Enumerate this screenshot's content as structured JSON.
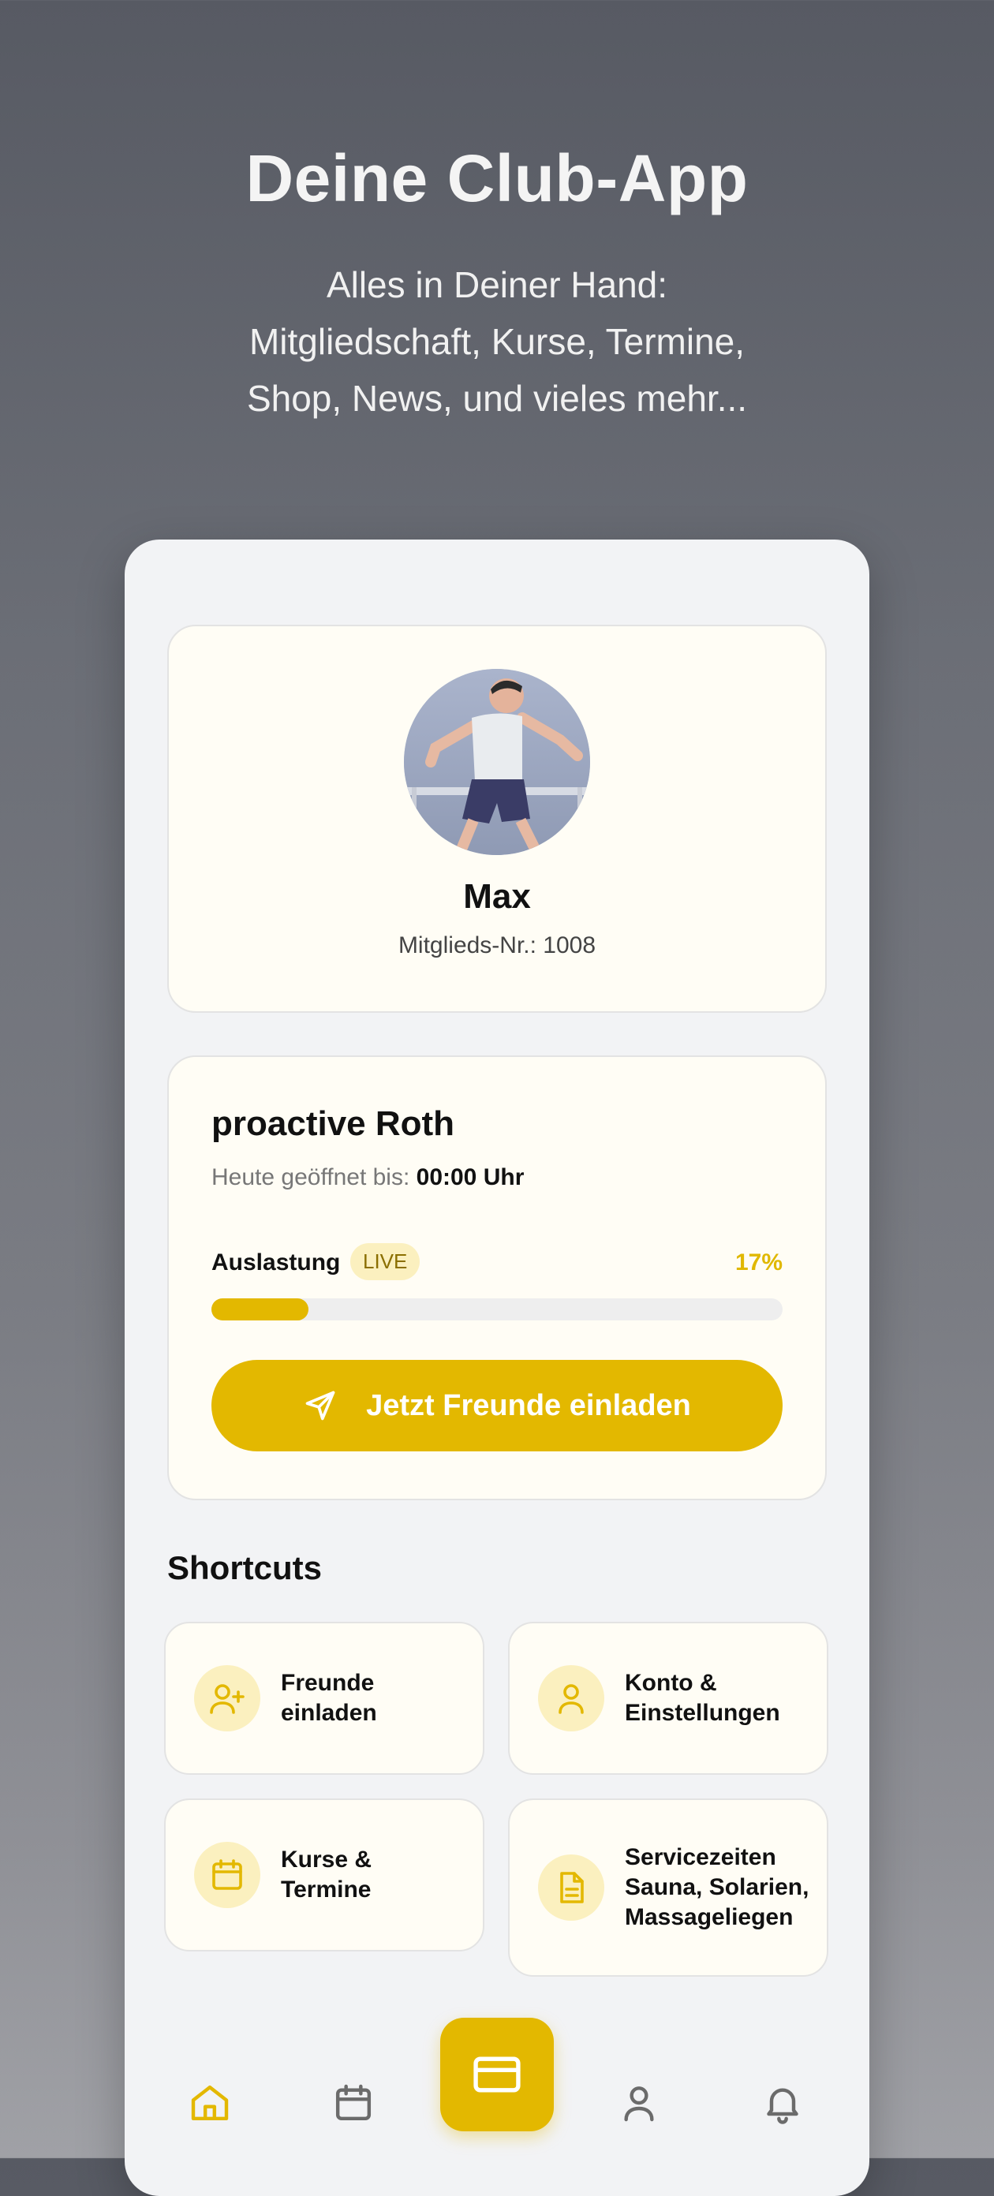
{
  "hero": {
    "title": "Deine Club-App",
    "subtitle_lines": [
      "Alles in Deiner Hand:",
      "Mitgliedschaft, Kurse, Termine,",
      "Shop, News, und vieles mehr..."
    ]
  },
  "profile": {
    "name": "Max",
    "member_no": "Mitglieds-Nr.: 1008"
  },
  "club": {
    "name": "proactive Roth",
    "open_label": "Heute geöffnet bis:",
    "open_time": "00:00 Uhr",
    "load_label": "Auslastung",
    "live_badge": "LIVE",
    "load_percent_text": "17%",
    "load_fraction": 0.17,
    "invite_label": "Jetzt Freunde einladen"
  },
  "shortcuts": {
    "title": "Shortcuts",
    "items": [
      {
        "lines": [
          "Freunde",
          "einladen"
        ],
        "icon": "user-plus-icon"
      },
      {
        "lines": [
          "Konto &",
          "Einstellungen"
        ],
        "icon": "user-icon"
      },
      {
        "lines": [
          "Kurse &",
          "Termine"
        ],
        "icon": "calendar-icon"
      },
      {
        "lines": [
          "Servicezeiten",
          "Sauna, Solarien,",
          "Massageliegen"
        ],
        "icon": "document-icon"
      }
    ]
  },
  "tabbar": {
    "items": [
      "home-icon",
      "calendar-icon",
      "card-icon",
      "user-icon",
      "bell-icon"
    ],
    "active": "home-icon"
  },
  "colors": {
    "accent": "#e3b800",
    "accent_soft": "#fbf0bf",
    "card_bg": "#fffdf5",
    "phone_bg": "#f2f3f5"
  }
}
